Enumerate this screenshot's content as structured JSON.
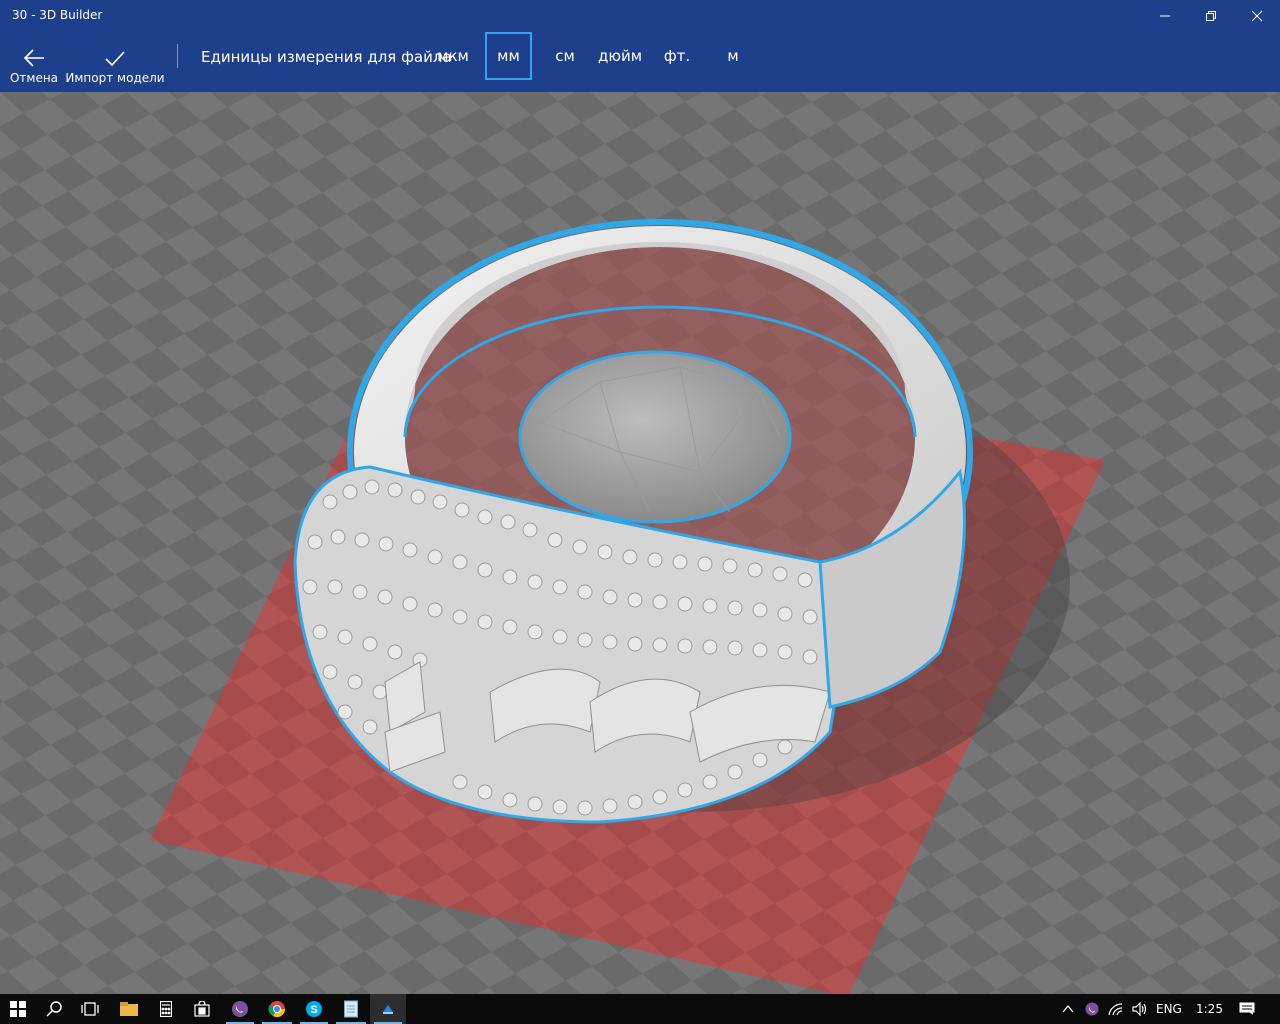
{
  "window": {
    "title": "30 - 3D Builder"
  },
  "toolbar": {
    "cancel_label": "Отмена",
    "import_label": "Импорт модели",
    "units_label": "Единицы измерения для файла",
    "units": [
      "мкм",
      "мм",
      "см",
      "дюйм",
      "фт.",
      "м"
    ],
    "selected_unit": "мм"
  },
  "colors": {
    "accent": "#1e3f8c",
    "selection_outline": "#2ea8e8",
    "build_plate": "#b04a4a",
    "model": "#dcdcdc"
  },
  "taskbar": {
    "items": [
      "windows-icon",
      "search-icon",
      "task-view-icon",
      "file-explorer-icon",
      "calculator-icon",
      "store-icon",
      "viber-icon",
      "chrome-icon",
      "skype-icon",
      "notepad-icon",
      "3d-builder-icon"
    ],
    "language": "ENG",
    "time": "1:25"
  }
}
